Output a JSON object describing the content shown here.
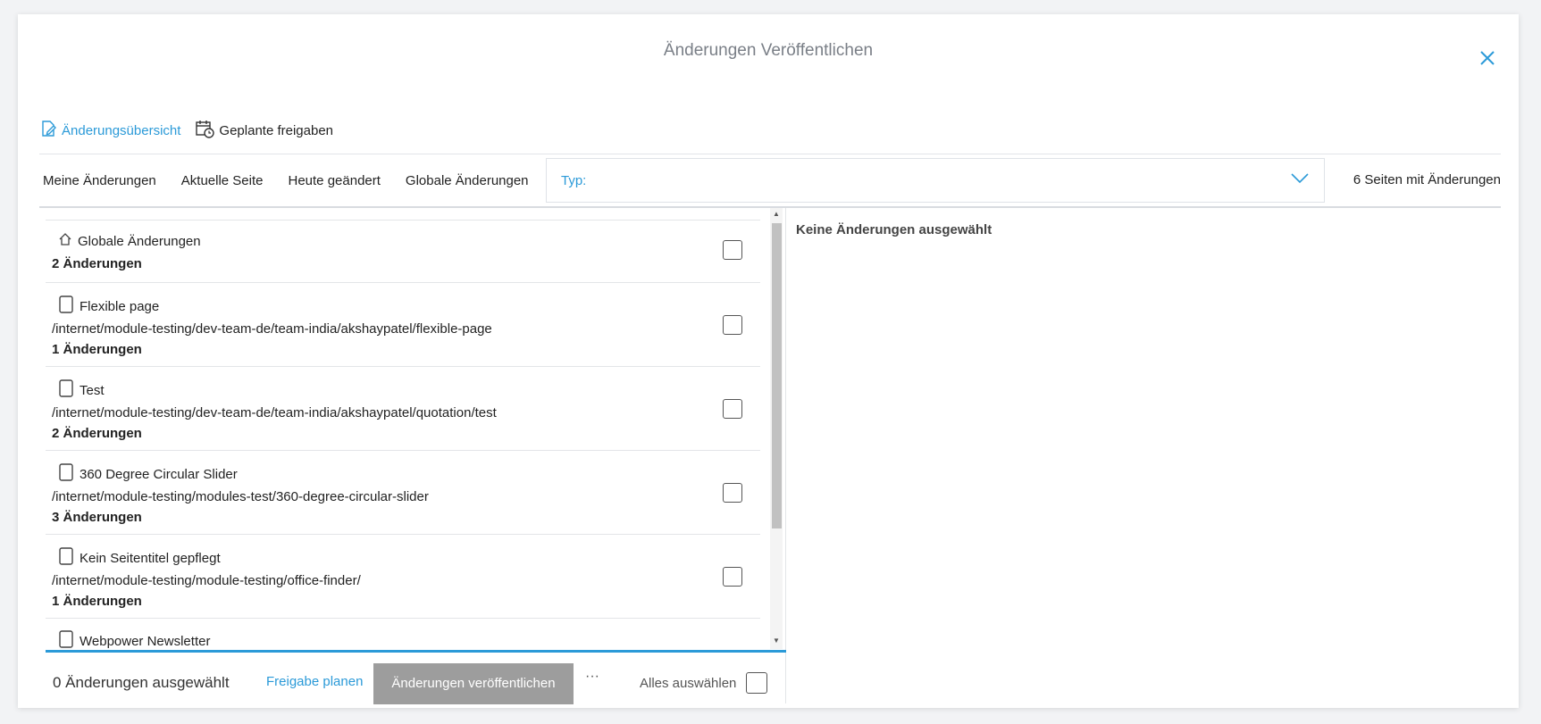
{
  "dialog": {
    "title": "Änderungen Veröffentlichen"
  },
  "tabs": [
    {
      "label": "Änderungsübersicht",
      "icon": "edit-icon",
      "active": true
    },
    {
      "label": "Geplante freigaben",
      "icon": "calendar-clock-icon",
      "active": false
    }
  ],
  "filters": [
    "Meine Änderungen",
    "Aktuelle Seite",
    "Heute geändert",
    "Globale Änderungen"
  ],
  "type_select": {
    "label": "Typ:"
  },
  "pages_count": "6 Seiten mit Änderungen",
  "items": [
    {
      "icon": "home-icon",
      "title": "Globale Änderungen",
      "path": "",
      "count": "2 Änderungen"
    },
    {
      "icon": "page-icon",
      "title": "Flexible page",
      "path": "/internet/module-testing/dev-team-de/team-india/akshaypatel/flexible-page",
      "count": "1 Änderungen"
    },
    {
      "icon": "page-icon",
      "title": "Test",
      "path": "/internet/module-testing/dev-team-de/team-india/akshaypatel/quotation/test",
      "count": "2 Änderungen"
    },
    {
      "icon": "page-icon",
      "title": "360 Degree Circular Slider",
      "path": "/internet/module-testing/modules-test/360-degree-circular-slider",
      "count": "3 Änderungen"
    },
    {
      "icon": "page-icon",
      "title": "Kein Seitentitel gepflegt",
      "path": "/internet/module-testing/module-testing/office-finder/",
      "count": "1 Änderungen"
    },
    {
      "icon": "page-icon",
      "title": "Webpower Newsletter",
      "path": "",
      "count": ""
    }
  ],
  "details": {
    "empty_text": "Keine Änderungen ausgewählt"
  },
  "footer": {
    "selected_text": "0 Änderungen ausgewählt",
    "schedule_label": "Freigabe planen",
    "publish_label": "Änderungen veröffentlichen",
    "more_label": "···",
    "select_all_label": "Alles auswählen"
  },
  "colors": {
    "accent": "#2b9ad8",
    "disabled_button": "#9d9d9d"
  }
}
